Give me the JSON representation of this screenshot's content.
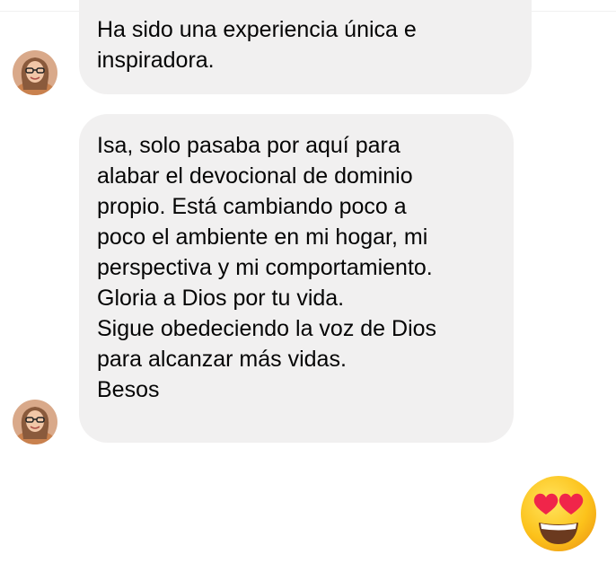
{
  "messages": [
    {
      "lines": [
        "Ha sido una experiencia única e",
        "inspiradora."
      ]
    },
    {
      "lines": [
        "Isa, solo pasaba por aquí para",
        "alabar el devocional de dominio",
        "propio. Está cambiando poco a",
        "poco el ambiente en mi hogar, mi",
        "perspectiva y mi comportamiento.",
        "Gloria a Dios por tu vida.",
        "Sigue obedeciendo la voz de Dios",
        "para alcanzar más vidas.",
        "Besos"
      ]
    }
  ],
  "reaction": {
    "icon": "heart-eyes-emoji-icon"
  },
  "colors": {
    "bubble_background": "#f1f0f0",
    "text": "#050505",
    "emoji_face": "#fbc02d",
    "emoji_hearts": "#f0254a"
  }
}
